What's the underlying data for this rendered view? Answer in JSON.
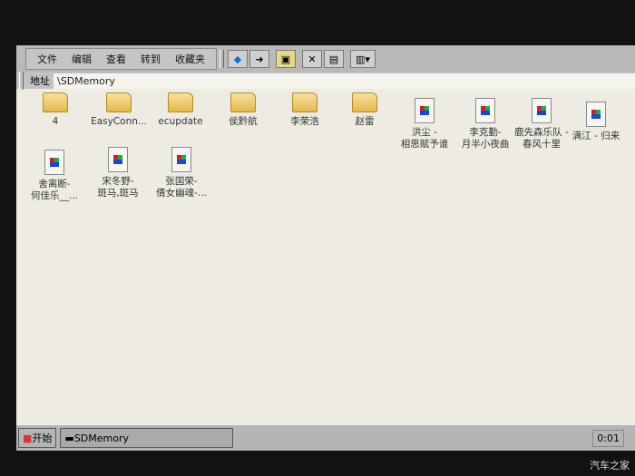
{
  "menu": [
    "文件",
    "编辑",
    "查看",
    "转到",
    "收藏夹"
  ],
  "address": {
    "label": "地址",
    "value": "\\SDMemory"
  },
  "folders": [
    "4",
    "EasyConn...",
    "ecupdate",
    "侯黔航",
    "李荣浩",
    "赵雷"
  ],
  "files": [
    [
      "洪尘 -",
      "相思赋予谁"
    ],
    [
      "李克勤-",
      "月半小夜曲"
    ],
    [
      "鹿先森乐队 -",
      "春风十里"
    ],
    [
      "满江 - 归来",
      ""
    ],
    [
      "舍离断-",
      "何佳乐__..."
    ],
    [
      "宋冬野-",
      "斑马,斑马"
    ],
    [
      "张国荣-",
      "倩女幽魂-..."
    ]
  ],
  "taskbar": {
    "start": "开始",
    "task": "SDMemory",
    "clock": "0:01"
  },
  "watermark": "汽车之家"
}
